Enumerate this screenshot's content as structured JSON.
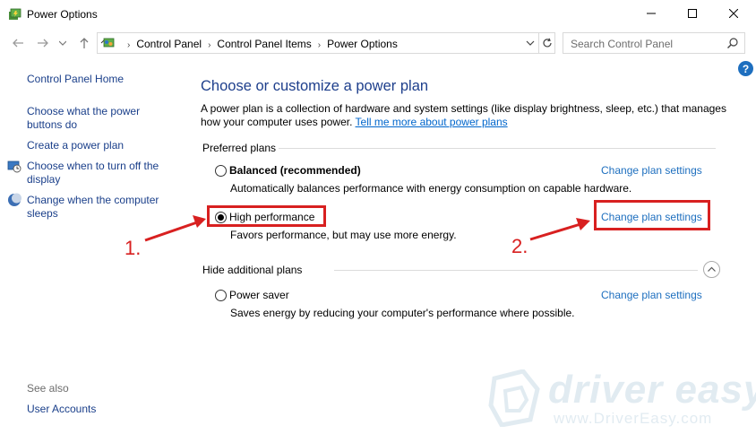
{
  "window": {
    "title": "Power Options"
  },
  "address_bar": {
    "breadcrumbs": [
      "Control Panel",
      "Control Panel Items",
      "Power Options"
    ],
    "search_placeholder": "Search Control Panel"
  },
  "help_label": "?",
  "sidebar": {
    "links": [
      {
        "label": "Control Panel Home"
      },
      {
        "label": "Choose what the power buttons do"
      },
      {
        "label": "Create a power plan"
      },
      {
        "label": "Choose when to turn off the display",
        "icon": "display-clock-icon"
      },
      {
        "label": "Change when the computer sleeps",
        "icon": "moon-icon"
      }
    ],
    "see_also": "See also",
    "user_accounts": "User Accounts"
  },
  "main": {
    "title": "Choose or customize a power plan",
    "description": "A power plan is a collection of hardware and system settings (like display brightness, sleep, etc.) that manages how your computer uses power. ",
    "learn_more": "Tell me more about power plans",
    "preferred_label": "Preferred plans",
    "hidden_label": "Hide additional plans",
    "plans": [
      {
        "name": "Balanced (recommended)",
        "bold": true,
        "selected": false,
        "description": "Automatically balances performance with energy consumption on capable hardware.",
        "link": "Change plan settings"
      },
      {
        "name": "High performance",
        "bold": false,
        "selected": true,
        "description": "Favors performance, but may use more energy.",
        "link": "Change plan settings"
      },
      {
        "name": "Power saver",
        "bold": false,
        "selected": false,
        "description": "Saves energy by reducing your computer's performance where possible.",
        "link": "Change plan settings"
      }
    ]
  },
  "annotations": {
    "step1": "1.",
    "step2": "2.",
    "color": "#d82020"
  },
  "watermark": {
    "brand": "driver easy",
    "url": "www.DriverEasy.com"
  },
  "colors": {
    "link": "#1e6fbf",
    "title": "#1e3f8c",
    "sidebar_link": "#1a3f8a"
  }
}
